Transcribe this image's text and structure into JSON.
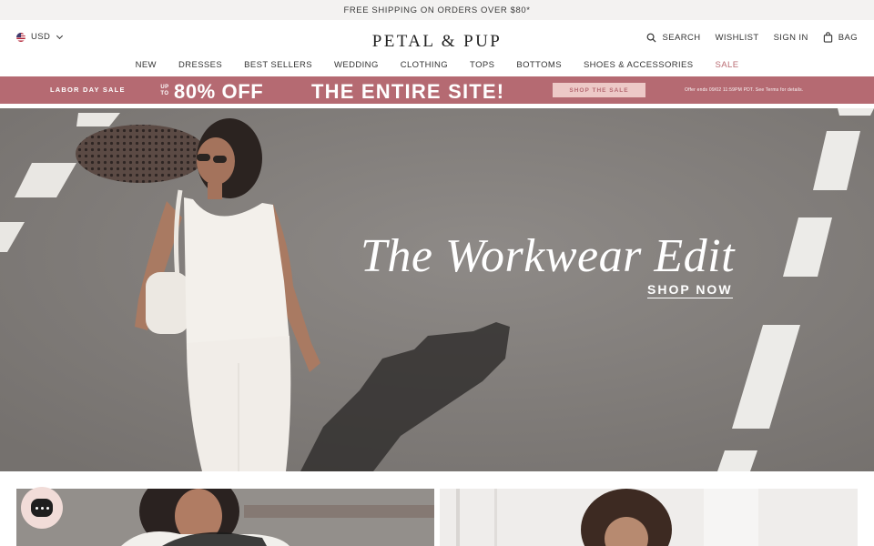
{
  "announcement": {
    "text": "FREE SHIPPING ON ORDERS OVER $80*"
  },
  "header": {
    "currency": "USD",
    "logo": "PETAL & PUP",
    "search_label": "SEARCH",
    "wishlist_label": "WISHLIST",
    "signin_label": "SIGN IN",
    "bag_label": "BAG"
  },
  "nav": {
    "items": [
      {
        "label": "NEW"
      },
      {
        "label": "DRESSES"
      },
      {
        "label": "BEST SELLERS"
      },
      {
        "label": "WEDDING"
      },
      {
        "label": "CLOTHING"
      },
      {
        "label": "TOPS"
      },
      {
        "label": "BOTTOMS"
      },
      {
        "label": "SHOES & ACCESSORIES"
      },
      {
        "label": "SALE"
      }
    ]
  },
  "promo": {
    "label": "LABOR DAY SALE",
    "up_to": "UP TO",
    "discount": "80% OFF",
    "headline": "THE ENTIRE SITE!",
    "button": "SHOP THE SALE",
    "fine_print": "Offer ends 09/02 11:59PM PDT. See Terms for details."
  },
  "hero": {
    "title": "The Workwear Edit",
    "cta": "SHOP NOW"
  },
  "colors": {
    "promo_bg": "#b56a72",
    "promo_button_bg": "#edc9c7",
    "sale_link": "#b96b72",
    "announcement_bg": "#f3f2f1"
  },
  "icons": [
    "us-flag-icon",
    "chevron-down-icon",
    "search-icon",
    "bag-icon",
    "chat-icon"
  ]
}
